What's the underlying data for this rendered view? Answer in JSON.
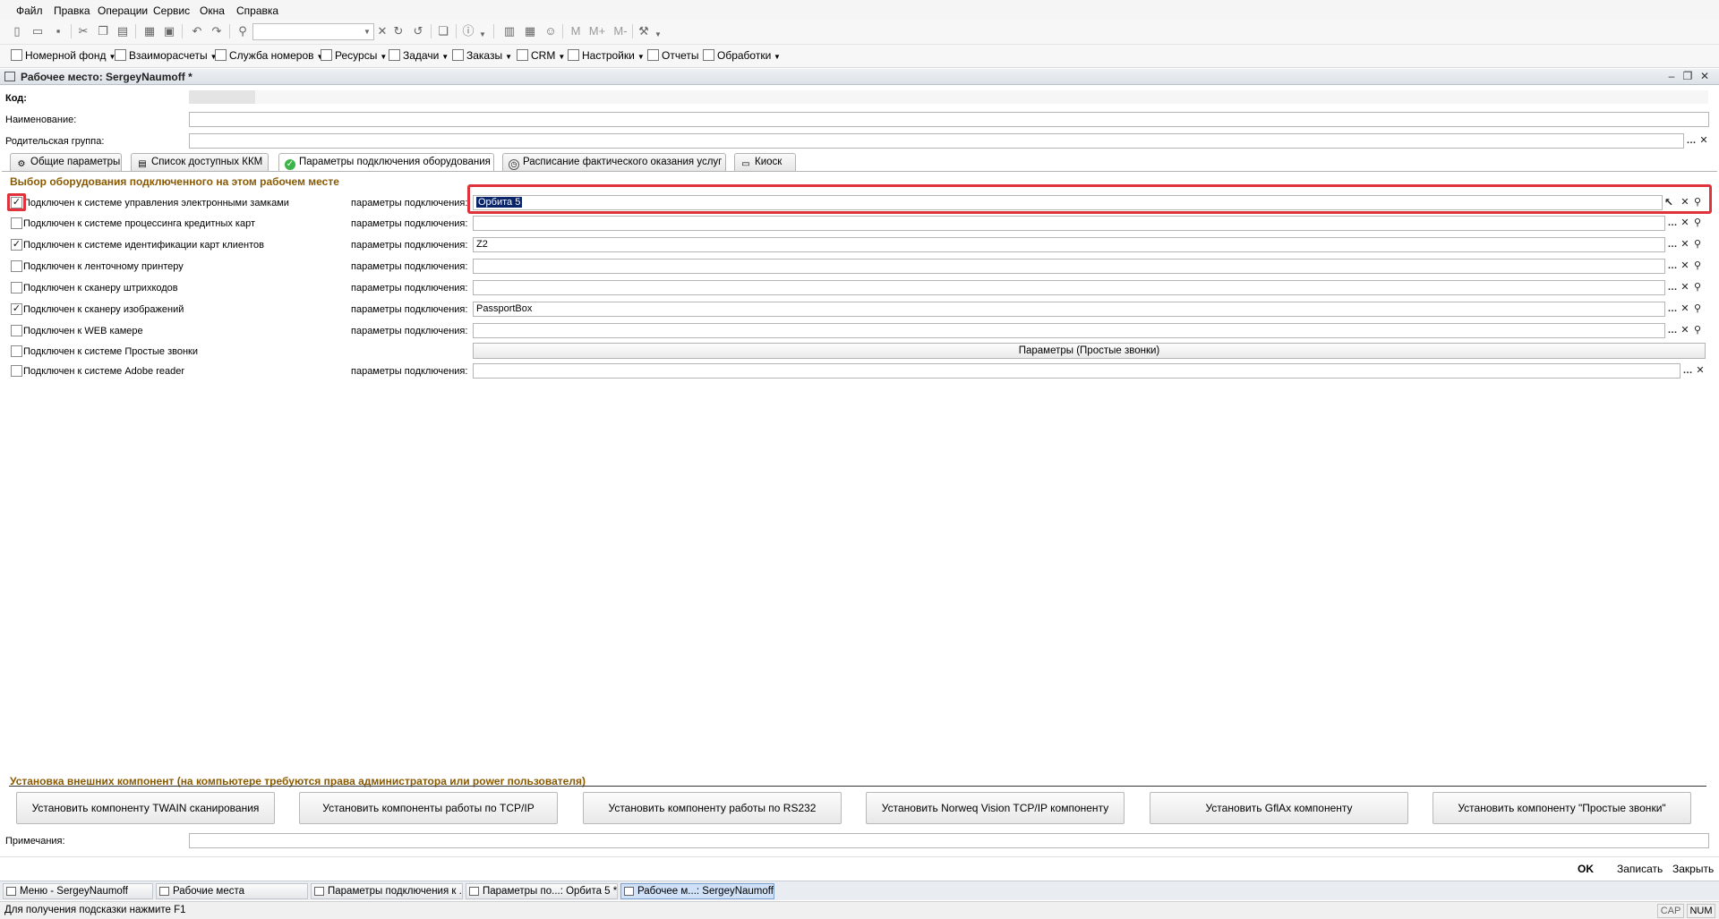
{
  "menu": [
    "Файл",
    "Правка",
    "Операции",
    "Сервис",
    "Окна",
    "Справка"
  ],
  "toolbar2": [
    {
      "label": "Номерной фонд",
      "dropdown": true
    },
    {
      "label": "Взаиморасчеты",
      "dropdown": true
    },
    {
      "label": "Служба номеров",
      "dropdown": true
    },
    {
      "label": "Ресурсы",
      "dropdown": true
    },
    {
      "label": "Задачи",
      "dropdown": true
    },
    {
      "label": "Заказы",
      "dropdown": true
    },
    {
      "label": "CRM",
      "dropdown": true
    },
    {
      "label": "Настройки",
      "dropdown": true
    },
    {
      "label": "Отчеты",
      "dropdown": false
    },
    {
      "label": "Обработки",
      "dropdown": false
    }
  ],
  "toolbar1_text": {
    "m": "M",
    "mplus": "M+",
    "mminus": "M-"
  },
  "window": {
    "title": "Рабочее место: SergeyNaumoff *"
  },
  "form": {
    "code_label": "Код:",
    "name_label": "Наименование:",
    "name_value": "",
    "parent_label": "Родительская группа:",
    "parent_value": "",
    "notes_label": "Примечания:",
    "notes_value": ""
  },
  "tabs": [
    {
      "label": "Общие параметры",
      "icon": "gear-icon",
      "active": false
    },
    {
      "label": "Список доступных ККМ",
      "icon": "register-icon",
      "active": false
    },
    {
      "label": "Параметры подключения оборудования",
      "icon": "check-circle-icon",
      "active": true
    },
    {
      "label": "Расписание фактического оказания услуг",
      "icon": "clock-icon",
      "active": false
    },
    {
      "label": "Киоск",
      "icon": "kiosk-icon",
      "active": false
    }
  ],
  "equipment": {
    "title": "Выбор оборудования подключенного на этом рабочем месте",
    "param_label": "параметры подключения:",
    "rows": [
      {
        "label": "Подключен к системе управления электронными замками",
        "checked": true,
        "value": "Орбита  5",
        "selected": true
      },
      {
        "label": "Подключен к системе процессинга кредитных карт",
        "checked": false,
        "value": ""
      },
      {
        "label": "Подключен к системе идентификации карт клиентов",
        "checked": true,
        "value": "Z2"
      },
      {
        "label": "Подключен к ленточному принтеру",
        "checked": false,
        "value": ""
      },
      {
        "label": "Подключен к сканеру штрихкодов",
        "checked": false,
        "value": ""
      },
      {
        "label": "Подключен к сканеру изображений",
        "checked": true,
        "value": "PassportBox"
      },
      {
        "label": "Подключен к WEB камере",
        "checked": false,
        "value": ""
      },
      {
        "label": "Подключен к системе Простые звонки",
        "checked": false,
        "button": "Параметры (Простые звонки)"
      },
      {
        "label": "Подключен к системе Adobe reader",
        "checked": false,
        "value": ""
      }
    ]
  },
  "install": {
    "title": "Установка внешних компонент (на компьютере требуются права администратора или power пользователя)",
    "buttons": [
      "Установить компоненту TWAIN сканирования",
      "Установить компоненты работы по TCP/IP",
      "Установить компоненту работы по RS232",
      "Установить Norweq Vision TCP/IP компоненту",
      "Установить GflAx компоненту",
      "Установить компоненту \"Простые звонки\""
    ]
  },
  "actions": {
    "ok": "OK",
    "save": "Записать",
    "close": "Закрыть"
  },
  "taskbar": [
    {
      "label": "Меню - SergeyNaumoff",
      "active": false
    },
    {
      "label": "Рабочие места",
      "active": false
    },
    {
      "label": "Параметры подключения к ...",
      "active": false
    },
    {
      "label": "Параметры по...: Орбита  5 *",
      "active": false
    },
    {
      "label": "Рабочее м...: SergeyNaumoff *",
      "active": true
    }
  ],
  "status": {
    "hint": "Для получения подсказки нажмите F1",
    "cap": "CAP",
    "num": "NUM"
  },
  "colors": {
    "highlight": "#e0323a",
    "section_title": "#8a5a00",
    "selection": "#0a246a"
  }
}
